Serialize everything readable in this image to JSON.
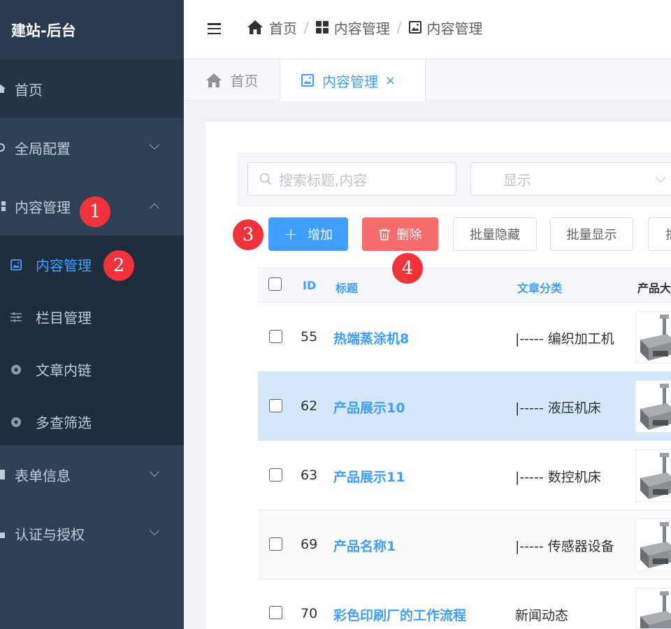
{
  "brand": "建站-后台",
  "sidebar": {
    "items": [
      {
        "label": "首页"
      },
      {
        "label": "全局配置"
      },
      {
        "label": "内容管理"
      },
      {
        "label": "表单信息"
      },
      {
        "label": "认证与授权"
      }
    ],
    "submenu": [
      {
        "label": "内容管理"
      },
      {
        "label": "栏目管理"
      },
      {
        "label": "文章内链"
      },
      {
        "label": "多查筛选"
      }
    ]
  },
  "breadcrumb": [
    "首页",
    "内容管理",
    "内容管理"
  ],
  "tabs": [
    {
      "label": "首页"
    },
    {
      "label": "内容管理",
      "close": "×"
    }
  ],
  "filters": {
    "search_placeholder": "搜索标题,内容",
    "select_value": "显示"
  },
  "toolbar": {
    "add": "增加",
    "delete": "删除",
    "batch_hide": "批量隐藏",
    "batch_show": "批量显示",
    "more": "批"
  },
  "table": {
    "columns": [
      "ID",
      "标题",
      "文章分类",
      "产品大"
    ],
    "rows": [
      {
        "id": "55",
        "title": "热端蒸涂机8",
        "category": "|----- 编织加工机"
      },
      {
        "id": "62",
        "title": "产品展示10",
        "category": "|----- 液压机床"
      },
      {
        "id": "63",
        "title": "产品展示11",
        "category": "|----- 数控机床"
      },
      {
        "id": "69",
        "title": "产品名称1",
        "category": "|----- 传感器设备"
      },
      {
        "id": "70",
        "title": "彩色印刷厂的工作流程",
        "category": "新闻动态"
      }
    ]
  },
  "annotations": [
    "1",
    "2",
    "3",
    "4"
  ],
  "colors": {
    "sidebar_bg": "#304156",
    "primary": "#409eff",
    "danger": "#f56c6c",
    "badge": "#f0333b",
    "row_highlight": "#d5e7f9"
  }
}
